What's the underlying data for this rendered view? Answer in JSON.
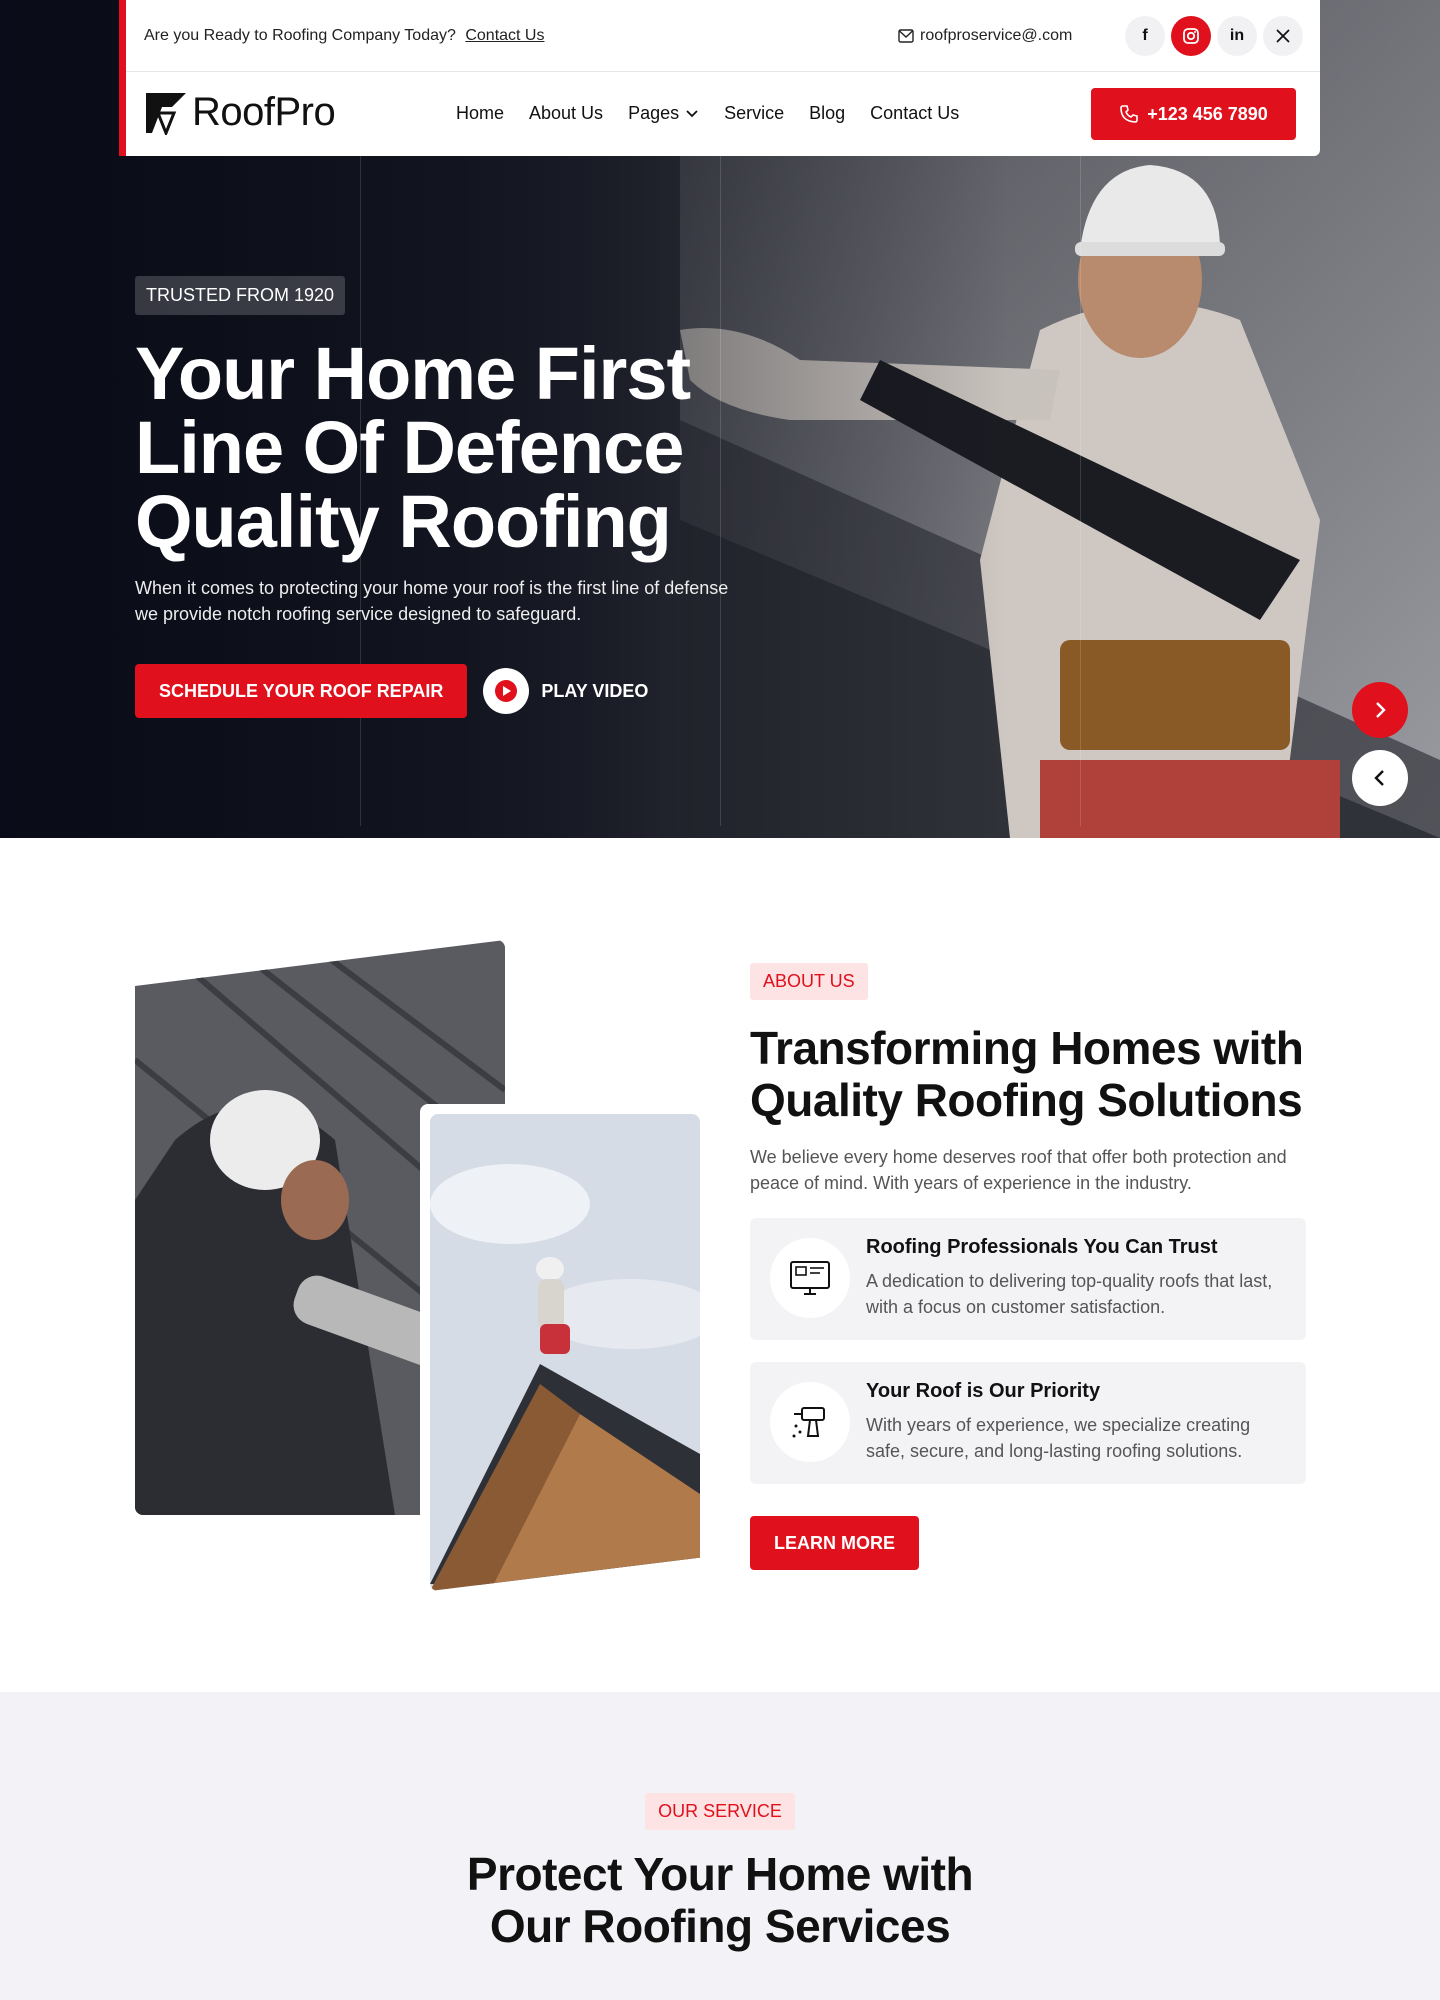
{
  "topbar": {
    "prompt": "Are you Ready to Roofing Company Today?",
    "contact_link": "Contact Us",
    "email": "roofproservice@.com",
    "socials": [
      "facebook-icon",
      "instagram-icon",
      "linkedin-icon",
      "x-icon"
    ]
  },
  "header": {
    "logo": "RoofPro",
    "nav": [
      "Home",
      "About Us",
      "Pages",
      "Service",
      "Blog",
      "Contact Us"
    ],
    "phone": "+123 456 7890"
  },
  "hero": {
    "badge": "TRUSTED FROM 1920",
    "title": "Your Home First Line Of Defence Quality Roofing",
    "description": "When it comes to protecting your home your roof is the first line of defense we provide notch roofing service designed to safeguard.",
    "cta": "SCHEDULE YOUR ROOF REPAIR",
    "video": "PLAY VIDEO"
  },
  "about": {
    "badge": "ABOUT US",
    "title": "Transforming Homes with Quality Roofing Solutions",
    "description": "We believe every home deserves roof that offer both protection and peace of mind. With years of experience in the industry.",
    "features": [
      {
        "title": "Roofing Professionals You Can Trust",
        "description": "A dedication to delivering top-quality roofs that last, with a focus on customer satisfaction.",
        "icon": "monitor-icon"
      },
      {
        "title": "Your Roof is Our Priority",
        "description": "With years of experience, we specialize creating safe, secure, and long-lasting roofing solutions.",
        "icon": "drill-icon"
      }
    ],
    "button": "LEARN MORE"
  },
  "service": {
    "badge": "OUR SERVICE",
    "title": "Protect Your Home with Our Roofing Services"
  },
  "colors": {
    "accent": "#e0101c",
    "dark": "#111111"
  }
}
